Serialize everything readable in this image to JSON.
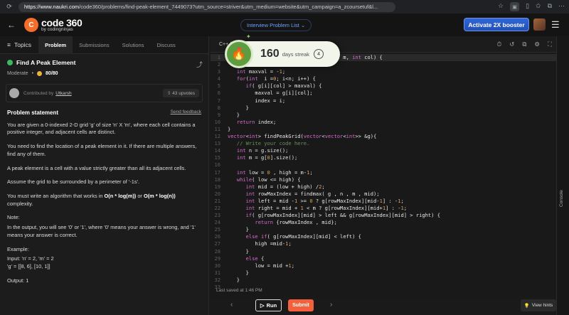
{
  "browser": {
    "url_host": "https://www.naukri.com",
    "url_path": "/code360/problems/find-peak-element_7449073?utm_source=striver&utm_medium=website&utm_campaign=a_zcoursetuf&l..."
  },
  "header": {
    "logo_badge": "C",
    "logo_main": "code 360",
    "logo_sub": "by codingninjas",
    "interview_list": "Interview Problem List ⌄",
    "activate_button": "Activate 2X booster"
  },
  "left": {
    "topics_label": "Topics",
    "tabs": [
      "Problem",
      "Submissions",
      "Solutions",
      "Discuss"
    ],
    "title": "Find A Peak Element",
    "difficulty": "Moderate",
    "score": "80/80",
    "contributed_by": "Contributed by",
    "author": "Utkarsh",
    "upvotes": "43 upvotes",
    "statement_heading": "Problem statement",
    "send_feedback": "Send feedback",
    "para1_a": "You are given a 0-indexed 2-D grid 'g' of size 'n' X 'm', where each cell contains a positive integer, and adjacent cells are distinct.",
    "para2": "You need to find the location of a peak element in it. If there are multiple answers, find any of them.",
    "para3": "A peak element is a cell with a value strictly greater than all its adjacent cells.",
    "para4": "Assume the grid to be surrounded by a perimeter of '-1s'.",
    "para5_a": "You must write an algorithm that works in ",
    "para5_b": "O(n * log(m))",
    "para5_c": " or ",
    "para5_d": "O(m * log(n))",
    "para5_e": " complexity.",
    "note_label": "Note:",
    "note_text": "In the output, you will see '0' or '1', where '0' means your answer is wrong, and '1' means your answer is correct.",
    "example_label": "Example:",
    "example_input": "Input: 'n' = 2, 'm' = 2",
    "example_grid": "'g' = [[8, 6], [10, 1]]",
    "example_output": "Output: 1"
  },
  "editor": {
    "language": "C++ (g",
    "last_saved": "Last saved at 1:46 PM"
  },
  "code_lines": [
    {
      "n": "1",
      "t": "                           int n, int m, int col) {"
    },
    {
      "n": "2",
      "t": "   int index = -1;"
    },
    {
      "n": "3",
      "t": "   int maxval = -1;"
    },
    {
      "n": "4",
      "t": "   for(int  i =0; i<n; i++) {"
    },
    {
      "n": "5",
      "t": "      if( g[i][col] > maxval) {"
    },
    {
      "n": "6",
      "t": "         maxval = g[i][col];"
    },
    {
      "n": "7",
      "t": "         index = i;"
    },
    {
      "n": "8",
      "t": "      }"
    },
    {
      "n": "9",
      "t": "   }"
    },
    {
      "n": "10",
      "t": "   return index;"
    },
    {
      "n": "11",
      "t": "}"
    },
    {
      "n": "12",
      "t": "vector<int> findPeakGrid(vector<vector<int>> &g){"
    },
    {
      "n": "13",
      "t": "   // Write your code here."
    },
    {
      "n": "14",
      "t": "   int n = g.size();"
    },
    {
      "n": "15",
      "t": "   int m = g[0].size();"
    },
    {
      "n": "16",
      "t": ""
    },
    {
      "n": "17",
      "t": "   int low = 0 , high = m-1;"
    },
    {
      "n": "18",
      "t": "   while( low <= high) {"
    },
    {
      "n": "19",
      "t": "      int mid = (low + high) /2;"
    },
    {
      "n": "20",
      "t": "      int rowMaxIndex = findmax( g , n , m , mid);"
    },
    {
      "n": "21",
      "t": "      int left = mid -1 >= 0 ? g[rowMaxIndex][mid-1] : -1;"
    },
    {
      "n": "22",
      "t": "      int right = mid + 1 < m ? g[rowMaxIndex][mid+1] : -1;"
    },
    {
      "n": "23",
      "t": "      if( g[rowMaxIndex][mid] > left && g[rowMaxIndex][mid] > right) {"
    },
    {
      "n": "24",
      "t": "         return {rowMaxIndex , mid};"
    },
    {
      "n": "25",
      "t": "      }"
    },
    {
      "n": "26",
      "t": "      else if( g[rowMaxIndex][mid] < left) {"
    },
    {
      "n": "27",
      "t": "         high =mid-1;"
    },
    {
      "n": "28",
      "t": "      }"
    },
    {
      "n": "29",
      "t": "      else {"
    },
    {
      "n": "30",
      "t": "         low = mid +1;"
    },
    {
      "n": "31",
      "t": "      }"
    },
    {
      "n": "32",
      "t": "   }"
    },
    {
      "n": "33",
      "t": ""
    }
  ],
  "streak": {
    "count": "160",
    "label": "days streak",
    "day": "4"
  },
  "bottom": {
    "run": "Run",
    "submit": "Submit",
    "hints": "View hints"
  },
  "console_label": "Console",
  "colors": {
    "accent_orange": "#f2613c",
    "brand_blue": "#2f66d8",
    "success_green": "#3cb95f",
    "streak_green": "#5d9d3f"
  }
}
